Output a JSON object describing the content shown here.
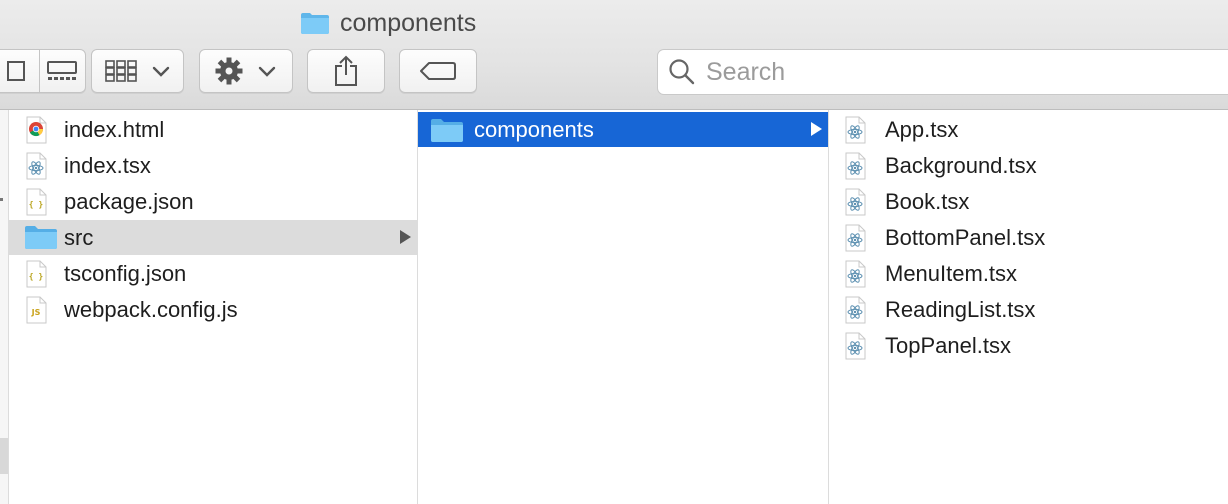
{
  "window": {
    "title": "components"
  },
  "toolbar": {
    "view_buttons": [
      "column-view",
      "gallery-view"
    ],
    "group_button": "group-by",
    "action_button": "action",
    "share_button": "share",
    "tag_button": "tags"
  },
  "search": {
    "placeholder": "Search"
  },
  "columns": [
    {
      "items": [
        {
          "name": "index.html",
          "icon": "chrome-html-icon"
        },
        {
          "name": "index.tsx",
          "icon": "react-file-icon"
        },
        {
          "name": "package.json",
          "icon": "json-file-icon"
        },
        {
          "name": "src",
          "icon": "folder-icon",
          "selected": "gray",
          "folder": true
        },
        {
          "name": "tsconfig.json",
          "icon": "json-file-icon"
        },
        {
          "name": "webpack.config.js",
          "icon": "js-file-icon"
        }
      ]
    },
    {
      "items": [
        {
          "name": "components",
          "icon": "folder-icon",
          "selected": "blue",
          "folder": true
        }
      ]
    },
    {
      "items": [
        {
          "name": "App.tsx",
          "icon": "react-file-icon"
        },
        {
          "name": "Background.tsx",
          "icon": "react-file-icon"
        },
        {
          "name": "Book.tsx",
          "icon": "react-file-icon"
        },
        {
          "name": "BottomPanel.tsx",
          "icon": "react-file-icon"
        },
        {
          "name": "MenuItem.tsx",
          "icon": "react-file-icon"
        },
        {
          "name": "ReadingList.tsx",
          "icon": "react-file-icon"
        },
        {
          "name": "TopPanel.tsx",
          "icon": "react-file-icon"
        }
      ]
    }
  ],
  "colors": {
    "selection_blue": "#1766d6",
    "selection_gray": "#dcdcdc",
    "folder_blue": "#6cc3f5"
  }
}
